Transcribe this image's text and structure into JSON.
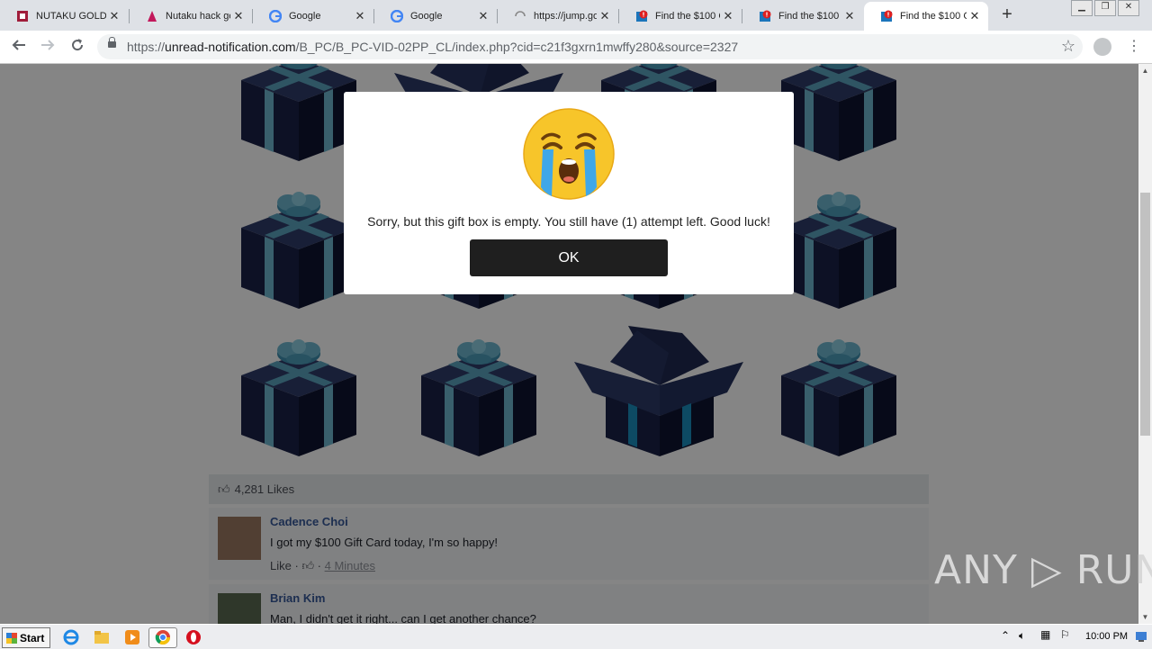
{
  "browser": {
    "tabs": [
      {
        "title": "NUTAKU GOLD",
        "favicon": "nutaku-icon",
        "active": false
      },
      {
        "title": "Nutaku hack go",
        "favicon": "nutaku-hack-icon",
        "active": false
      },
      {
        "title": "Google",
        "favicon": "google-icon",
        "active": false
      },
      {
        "title": "Google",
        "favicon": "google-icon",
        "active": false
      },
      {
        "title": "https://jump.go",
        "favicon": "loading-spinner-icon",
        "active": false
      },
      {
        "title": "Find the $100 G",
        "favicon": "alert-badge-icon",
        "active": false
      },
      {
        "title": "Find the $100 G",
        "favicon": "alert-badge-icon",
        "active": false
      },
      {
        "title": "Find the $100 G",
        "favicon": "alert-badge-icon",
        "active": true
      }
    ],
    "tab_close_glyph": "✕",
    "new_tab_glyph": "+",
    "window_buttons": [
      "▁",
      "❐",
      "✕"
    ],
    "address": {
      "scheme": "https://",
      "host": "unread-notification.com",
      "path": "/B_PC/B_PC-VID-02PP_CL/index.php?cid=c21f3gxrn1mwffy280&source=2327"
    }
  },
  "modal": {
    "emoji": "loudly-crying-face",
    "message": "Sorry, but this gift box is empty. You still have (1) attempt left. Good luck!",
    "button_label": "OK"
  },
  "feed": {
    "likes": "4,281 Likes",
    "comments": [
      {
        "name": "Cadence Choi",
        "text": "I got my $100 Gift Card today, I'm so happy!",
        "like_label": "Like",
        "time": "4 Minutes"
      },
      {
        "name": "Brian Kim",
        "text": "Man, I didn't get it right... can I get another chance?"
      }
    ]
  },
  "watermark": "ANY ▷ RUN",
  "taskbar": {
    "start_label": "Start",
    "clock": "10:00 PM"
  },
  "colors": {
    "gift_dark": "#121a38",
    "ribbon": "#6db6cf",
    "overlay": "rgba(0,0,0,0.48)",
    "ok_button": "#1f1f1f",
    "comment_name": "#365899"
  }
}
